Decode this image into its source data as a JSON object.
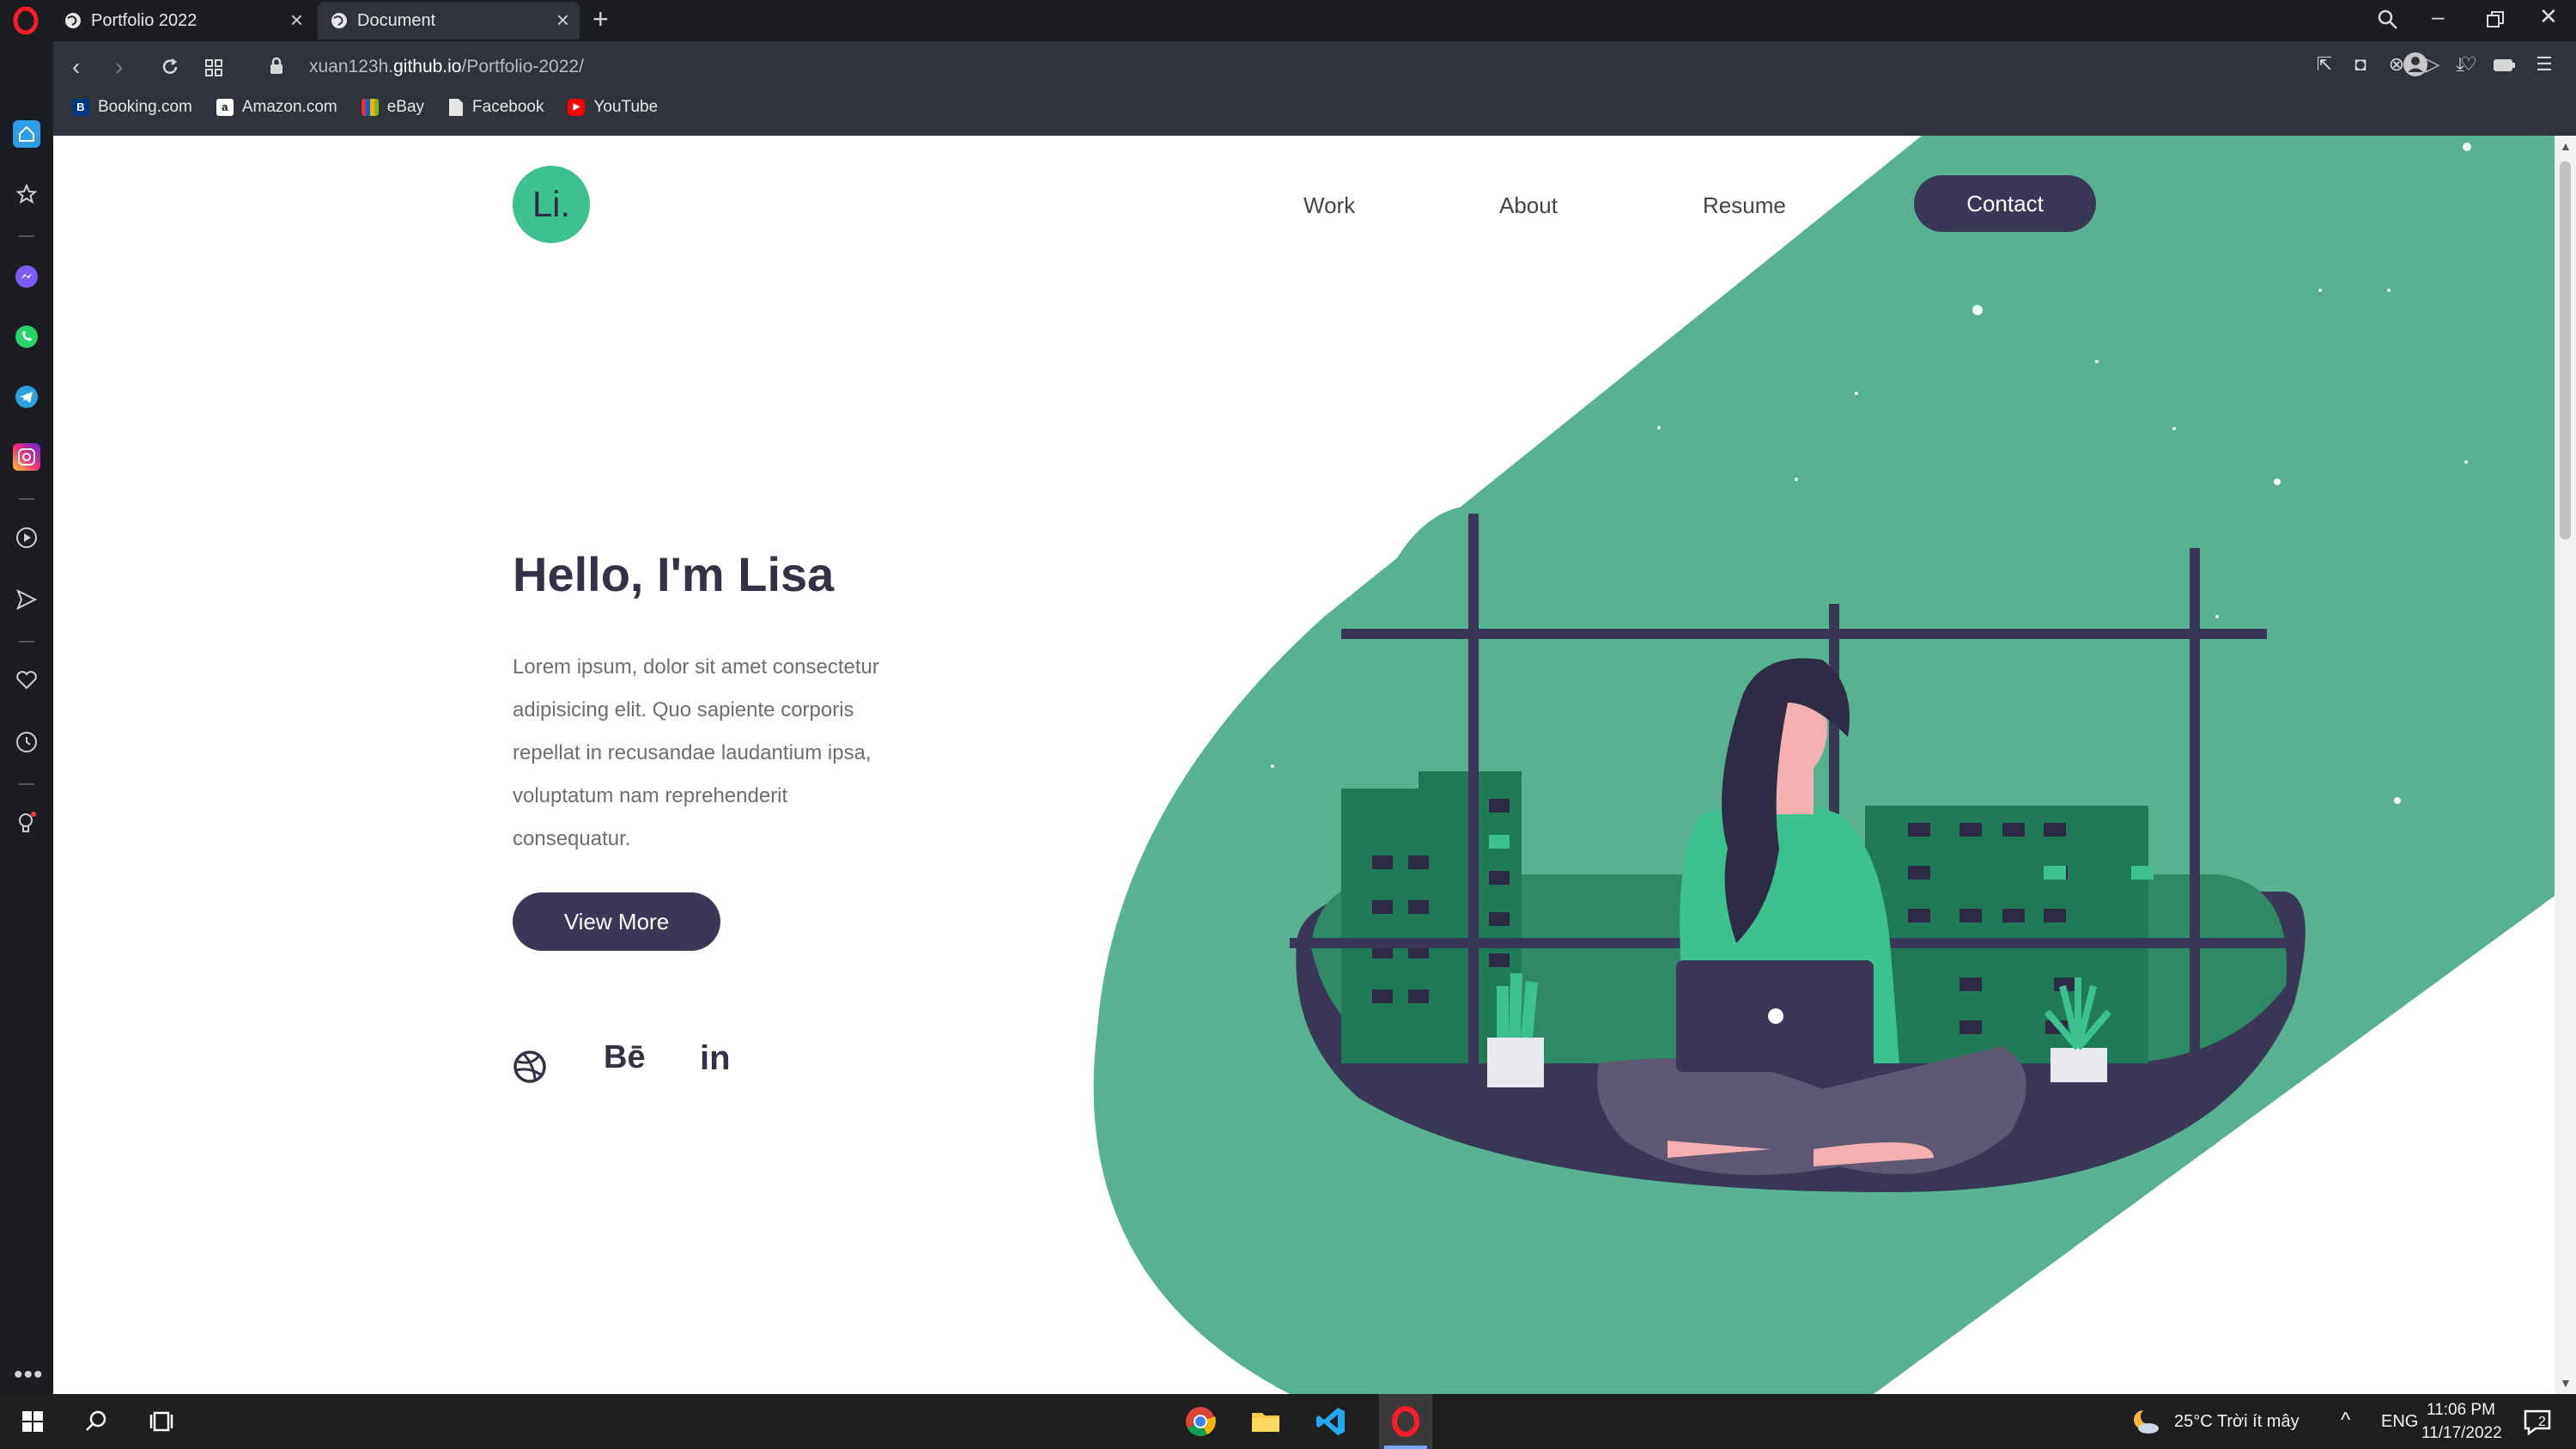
{
  "browser": {
    "tabs": [
      {
        "title": "Portfolio 2022"
      },
      {
        "title": "Document"
      }
    ],
    "url_prefix": "xuan123h.",
    "url_domain": "github.io",
    "url_path": "/Portfolio-2022/",
    "bookmarks": [
      {
        "label": "Booking.com",
        "icon": "B",
        "color": "#003580"
      },
      {
        "label": "Amazon.com",
        "icon": "a",
        "color": "#ffffff"
      },
      {
        "label": "eBay",
        "icon": "e",
        "color": "#e53238"
      },
      {
        "label": "Facebook",
        "icon": "file",
        "color": "#ffffff"
      },
      {
        "label": "YouTube",
        "icon": "▶",
        "color": "#ff0000"
      }
    ]
  },
  "page": {
    "logo": "Li.",
    "nav": {
      "work": "Work",
      "about": "About",
      "resume": "Resume",
      "contact": "Contact"
    },
    "hero": {
      "title": "Hello, I'm Lisa",
      "lines": [
        "Lorem ipsum, dolor sit amet consectetur",
        "adipisicing elit. Quo sapiente corporis",
        "repellat in recusandae laudantium ipsa,",
        "voluptatum nam reprehenderit",
        "consequatur."
      ],
      "button": "View More"
    },
    "social": {
      "behance": "Bē",
      "linkedin": "in"
    },
    "colors": {
      "accent": "#3dc28f",
      "dark": "#3b3857",
      "shape": "#56b290"
    }
  },
  "taskbar": {
    "weather": "25°C  Trời ít mây",
    "lang": "ENG",
    "time": "11:06 PM",
    "date": "11/17/2022",
    "notifications": "2"
  }
}
